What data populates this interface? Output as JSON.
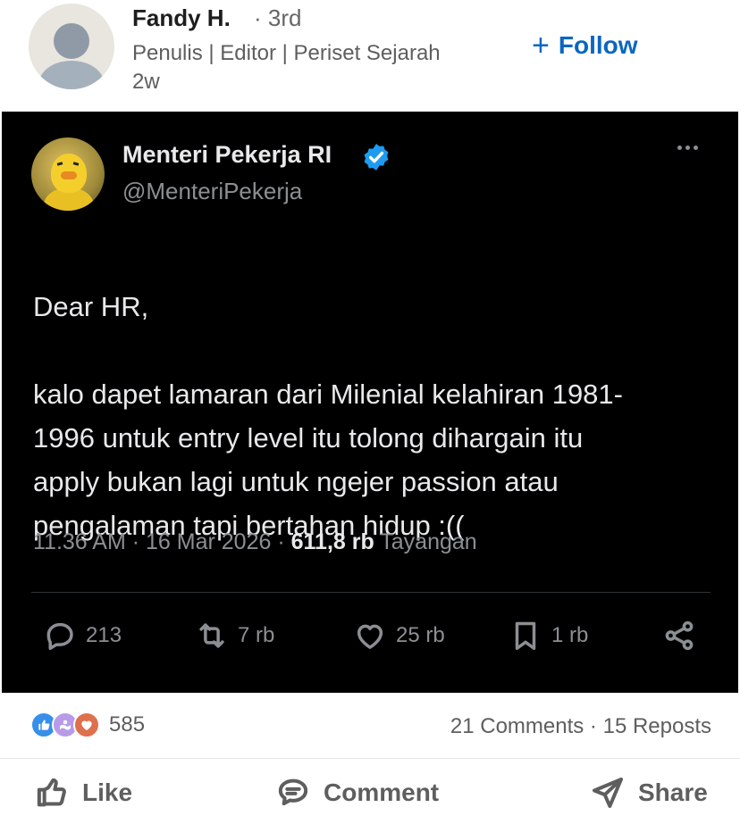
{
  "post": {
    "author": {
      "name": "Fandy H.",
      "degree": "· 3rd",
      "headline": "Penulis | Editor | Periset Sejarah",
      "age": "2w"
    },
    "follow": {
      "plus": "+",
      "label": "Follow"
    }
  },
  "tweet": {
    "display_name": "Menteri Pekerja RI",
    "handle": "@MenteriPekerja",
    "greeting": "Dear HR,",
    "body": "kalo dapet lamaran dari Milenial kelahiran 1981-\n1996 untuk entry level itu tolong dihargain itu\napply bukan lagi untuk ngejer passion atau\npengalaman tapi bertahan hidup :((",
    "time": "11.36 AM",
    "date": "16 Mar 2026",
    "separator": "·",
    "views_count": "611,8 rb",
    "views_label": "Tayangan",
    "actions": {
      "replies": "213",
      "reposts": "7 rb",
      "likes": "25 rb",
      "bookmarks": "1 rb"
    },
    "verified_color": "#1d9bf0"
  },
  "social": {
    "reaction_count": "585",
    "comments": "21 Comments",
    "separator": " · ",
    "reposts": "15 Reposts"
  },
  "action_bar": {
    "like": "Like",
    "comment": "Comment",
    "share": "Share"
  },
  "icons": {
    "reactions": [
      "like-reaction-icon",
      "support-reaction-icon",
      "love-reaction-icon"
    ]
  },
  "colors": {
    "accent": "#0a66c2",
    "tweet_bg": "#000000",
    "tweet_text": "#e7e9ea",
    "tweet_muted": "#8b8f93"
  }
}
